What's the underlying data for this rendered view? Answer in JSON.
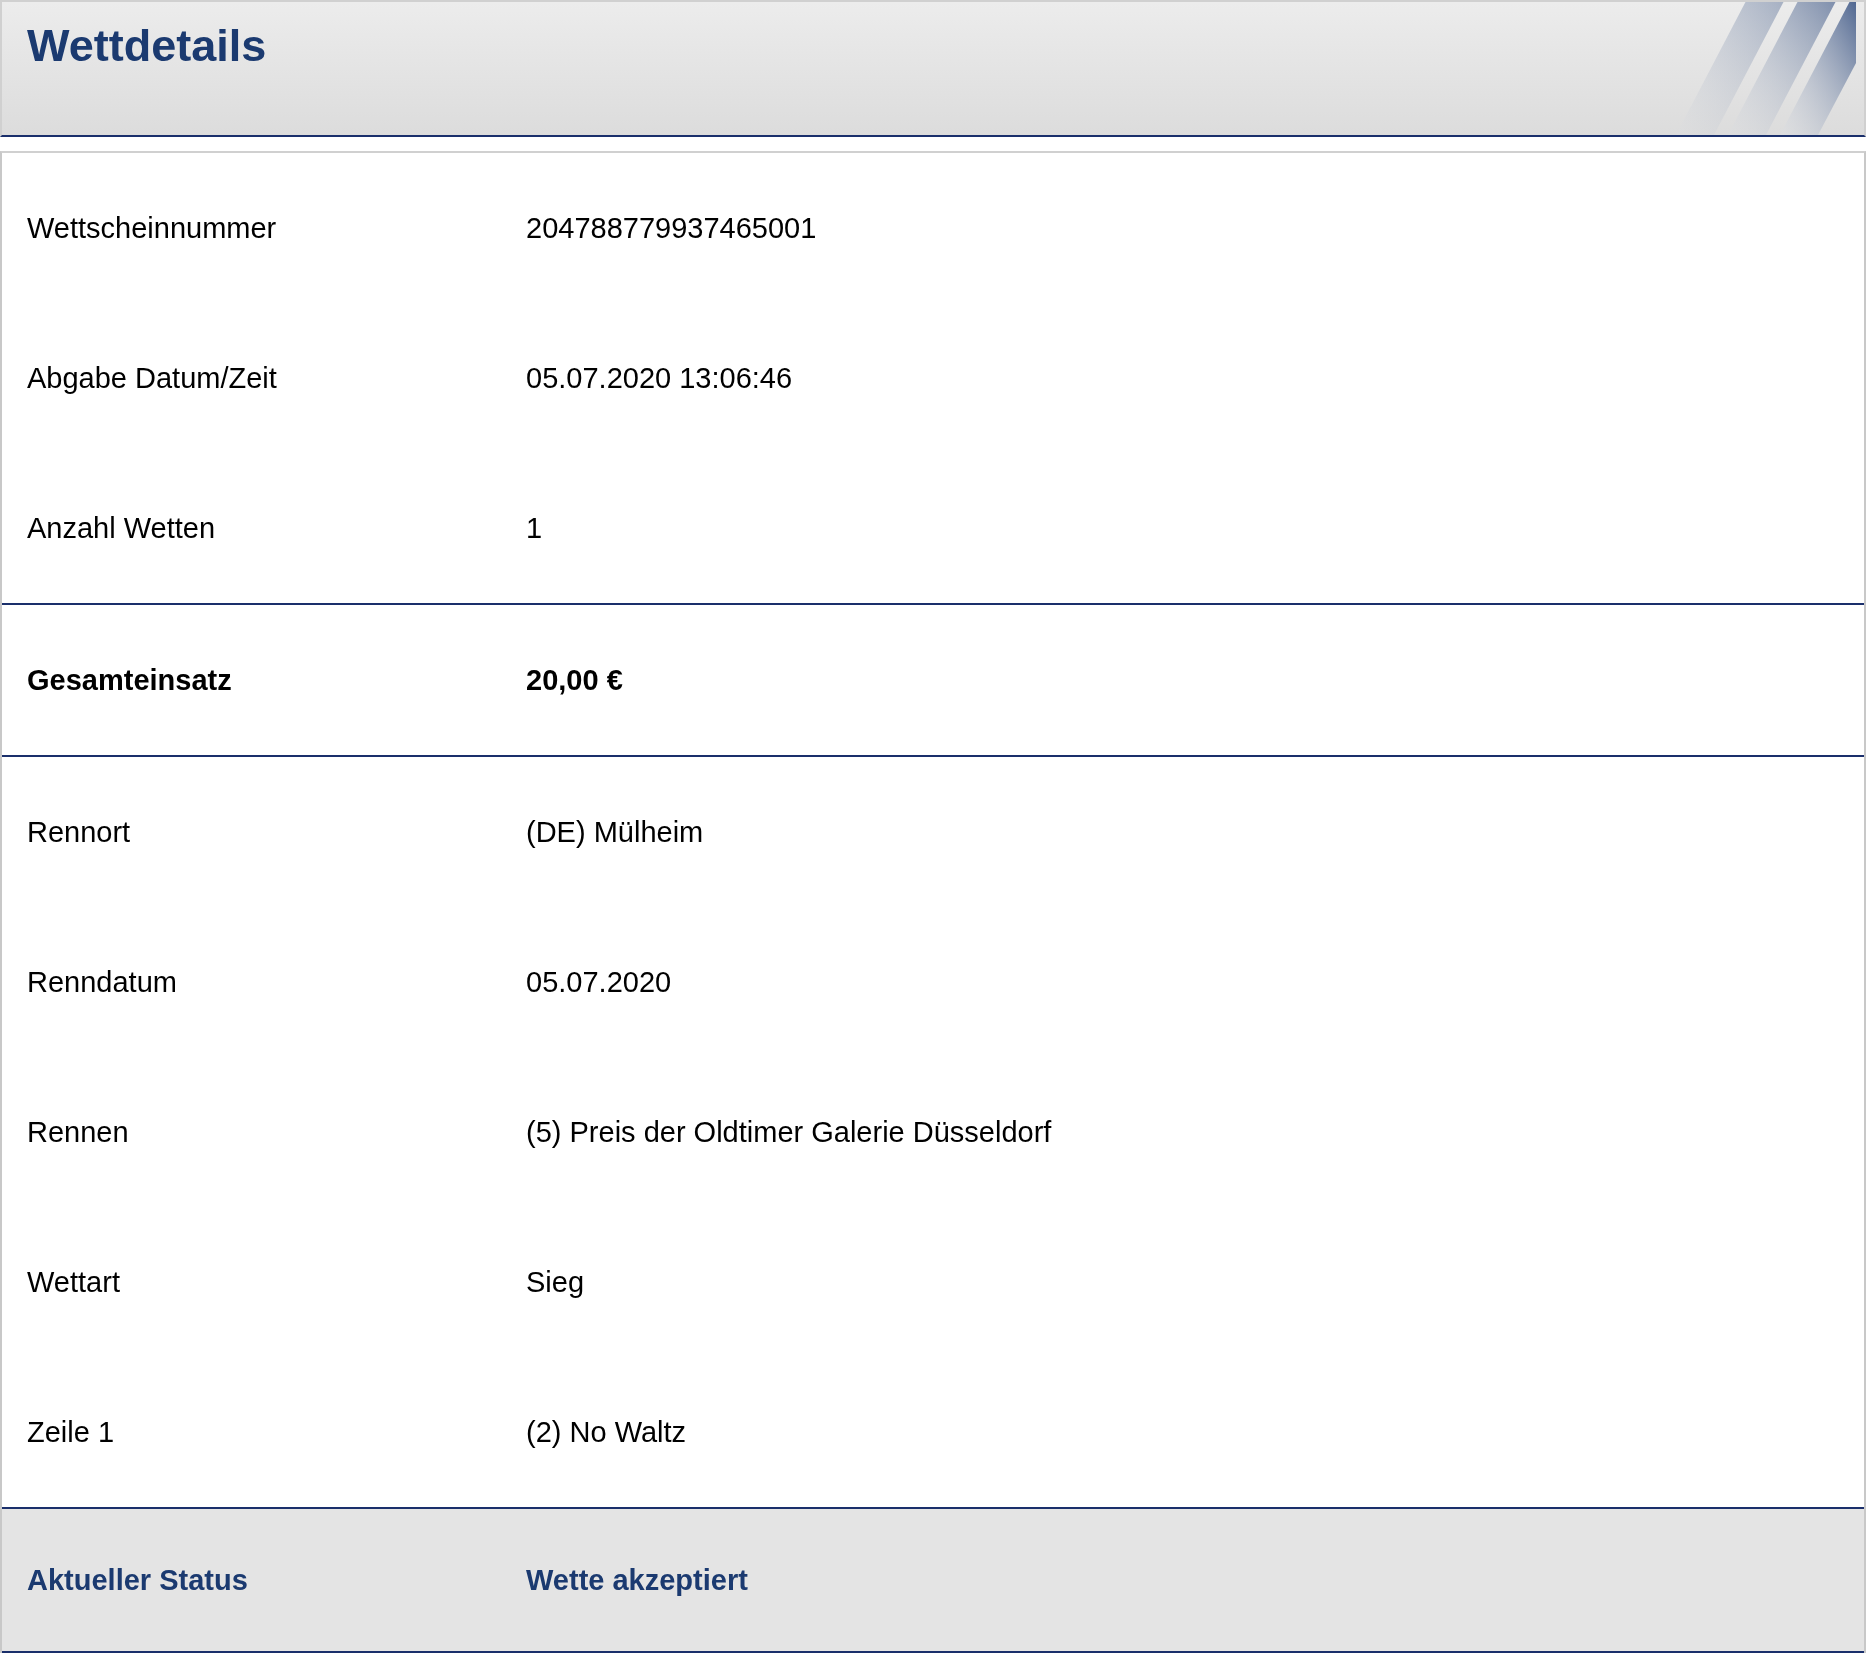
{
  "header": {
    "title": "Wettdetails"
  },
  "sections": [
    {
      "kind": "plain",
      "rows": [
        {
          "label": "Wettscheinnummer",
          "value": "204788779937465001"
        },
        {
          "label": "Abgabe Datum/Zeit",
          "value": "05.07.2020 13:06:46"
        },
        {
          "label": "Anzahl Wetten",
          "value": "1"
        }
      ]
    },
    {
      "kind": "total",
      "rows": [
        {
          "label": "Gesamteinsatz",
          "value": "20,00 €"
        }
      ]
    },
    {
      "kind": "plain",
      "rows": [
        {
          "label": "Rennort",
          "value": "(DE) Mülheim"
        },
        {
          "label": "Renndatum",
          "value": "05.07.2020"
        },
        {
          "label": "Rennen",
          "value": "(5) Preis der Oldtimer Galerie Düsseldorf"
        },
        {
          "label": "Wettart",
          "value": "Sieg"
        },
        {
          "label": "Zeile 1",
          "value": "(2) No Waltz"
        }
      ]
    },
    {
      "kind": "status",
      "rows": [
        {
          "label": "Aktueller Status",
          "value": "Wette akzeptiert"
        }
      ]
    }
  ]
}
